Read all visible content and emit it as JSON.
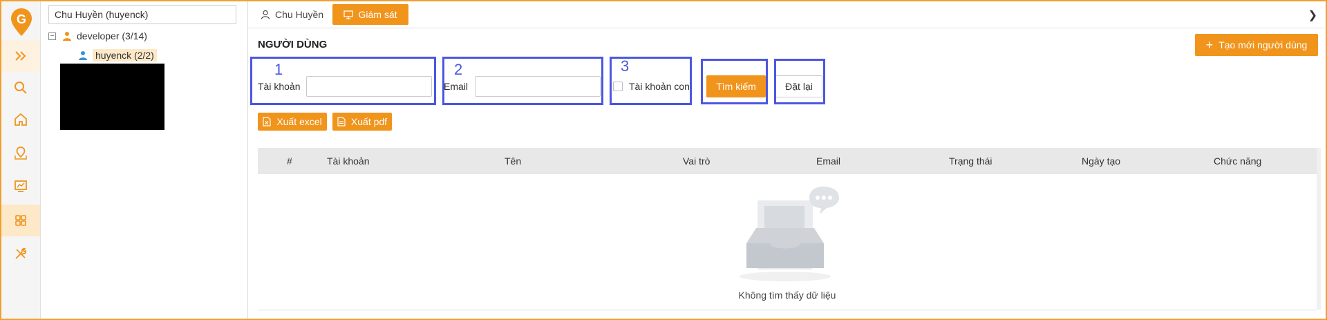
{
  "app": {
    "brand_color": "#f0941c",
    "logo_letter": "G"
  },
  "rail": {
    "items": [
      {
        "icon": "expand-icon"
      },
      {
        "icon": "search-icon"
      },
      {
        "icon": "home-icon"
      },
      {
        "icon": "map-pin-icon"
      },
      {
        "icon": "monitor-chart-icon"
      },
      {
        "icon": "grid-apps-icon"
      },
      {
        "icon": "tools-icon"
      }
    ]
  },
  "tree": {
    "search_value": "Chu Huyền (huyenck)",
    "expander": "−",
    "nodes": [
      {
        "label": "developer (3/14)",
        "icon": "user-group-icon"
      },
      {
        "label": "huyenck (2/2)",
        "icon": "user-icon"
      }
    ]
  },
  "tabs": [
    {
      "label": "Chu Huyền",
      "icon": "user-icon"
    },
    {
      "label": "Giám sát",
      "icon": "monitor-icon"
    }
  ],
  "tab_nav_arrow": "❯",
  "page": {
    "title": "NGƯỜI DÙNG",
    "create_button": "Tạo mới người dùng",
    "create_plus": "+"
  },
  "filters": {
    "account_label": "Tài khoản",
    "account_value": "",
    "email_label": "Email",
    "email_value": "",
    "sub_account_label": "Tài khoản con",
    "search_button": "Tìm kiếm",
    "reset_button": "Đặt lại"
  },
  "annotations": [
    "1",
    "2",
    "3"
  ],
  "export": {
    "excel_button": "Xuất excel",
    "pdf_button": "Xuất pdf"
  },
  "table": {
    "columns": [
      "#",
      "Tài khoản",
      "Tên",
      "Vai trò",
      "Email",
      "Trạng thái",
      "Ngày tạo",
      "Chức năng"
    ],
    "rows": [],
    "empty_text": "Không tìm thấy dữ liệu"
  }
}
